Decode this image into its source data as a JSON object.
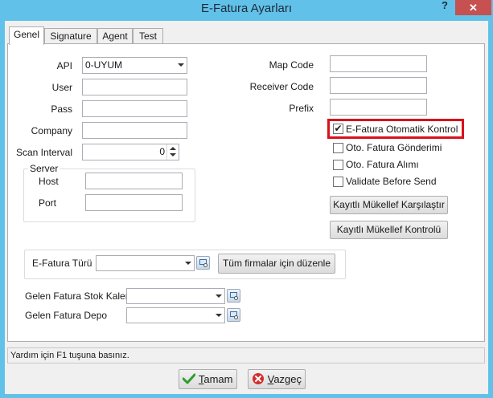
{
  "window": {
    "title": "E-Fatura Ayarları",
    "help_label": "?",
    "close_label": "✕"
  },
  "tabs": [
    {
      "label": "Genel",
      "active": true
    },
    {
      "label": "Signature",
      "active": false
    },
    {
      "label": "Agent",
      "active": false
    },
    {
      "label": "Test",
      "active": false
    }
  ],
  "form": {
    "api": {
      "label": "API",
      "value": "0-UYUM"
    },
    "user": {
      "label": "User",
      "value": ""
    },
    "pass": {
      "label": "Pass",
      "value": ""
    },
    "company": {
      "label": "Company",
      "value": ""
    },
    "scan_interval": {
      "label": "Scan Interval",
      "value": "0"
    },
    "server": {
      "title": "Server",
      "host_label": "Host",
      "host_value": "",
      "port_label": "Port",
      "port_value": ""
    },
    "map_code": {
      "label": "Map Code",
      "value": ""
    },
    "receiver_code": {
      "label": "Receiver Code",
      "value": ""
    },
    "prefix": {
      "label": "Prefix",
      "value": ""
    }
  },
  "checkboxes": [
    {
      "label": "E-Fatura Otomatik Kontrol",
      "checked": true,
      "highlighted": true
    },
    {
      "label": "Oto. Fatura Gönderimi",
      "checked": false
    },
    {
      "label": "Oto. Fatura Alımı",
      "checked": false
    },
    {
      "label": "Validate Before Send",
      "checked": false
    }
  ],
  "buttons": {
    "compare": "Kayıtlı Mükellef Karşılaştır",
    "check": "Kayıtlı Mükellef Kontrolü",
    "edit_all": "Tüm firmalar için düzenle"
  },
  "efatura_turu": {
    "label": "E-Fatura Türü",
    "value": ""
  },
  "incoming": {
    "stock_item_label": "Gelen Fatura Stok Kalemi",
    "stock_item_value": "",
    "warehouse_label": "Gelen Fatura Depo",
    "warehouse_value": ""
  },
  "status_text": "Yardım için F1 tuşuna basınız.",
  "footer": {
    "ok_accel": "T",
    "ok_rest": "amam",
    "cancel_accel": "V",
    "cancel_rest": "azgeç"
  },
  "colors": {
    "title_bar": "#62c1e9",
    "close_button": "#c75050",
    "highlight_border": "#d8121b",
    "ok_icon": "#2e9e2e",
    "cancel_icon": "#d32f2f"
  },
  "icons": [
    "help-icon",
    "close-icon",
    "dropdown-arrow-icon",
    "spin-up-icon",
    "spin-down-icon",
    "picker-icon",
    "checkmark-icon",
    "cancel-icon"
  ]
}
